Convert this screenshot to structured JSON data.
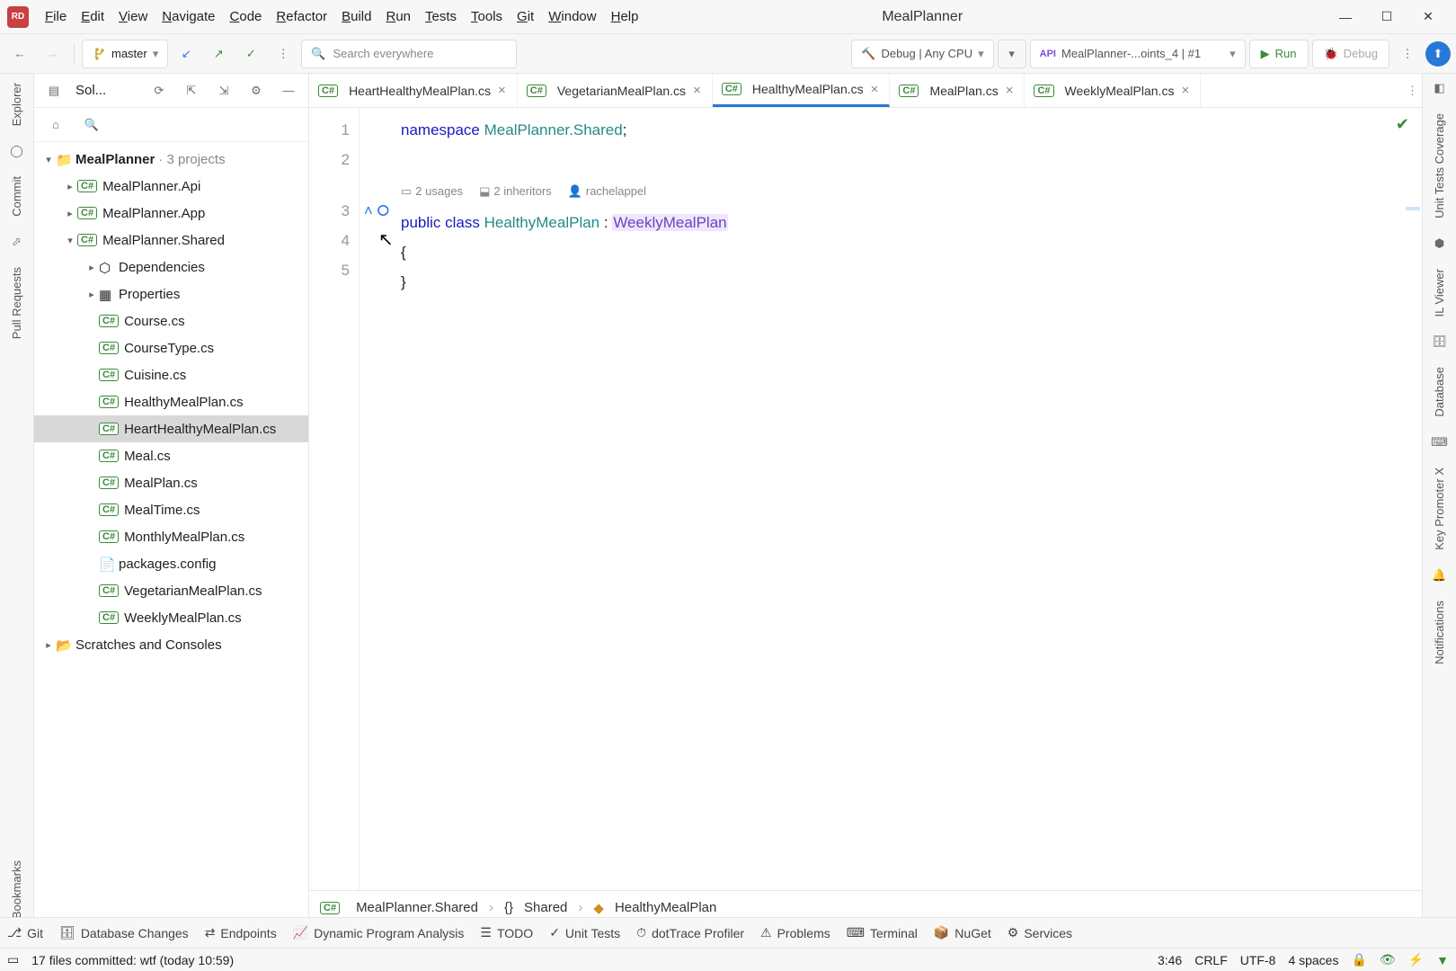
{
  "window": {
    "title": "MealPlanner"
  },
  "menu": [
    "File",
    "Edit",
    "View",
    "Navigate",
    "Code",
    "Refactor",
    "Build",
    "Run",
    "Tests",
    "Tools",
    "Git",
    "Window",
    "Help"
  ],
  "toolbar": {
    "branch": "master",
    "search_placeholder": "Search everywhere",
    "debug_config": "Debug | Any CPU",
    "run_config": "MealPlanner-...oints_4 | #1",
    "run_label": "Run",
    "debug_label": "Debug"
  },
  "explorer": {
    "title": "Sol...",
    "root": {
      "name": "MealPlanner",
      "suffix": "· 3 projects"
    },
    "projects": [
      "MealPlanner.Api",
      "MealPlanner.App",
      "MealPlanner.Shared"
    ],
    "shared_children_folders": [
      "Dependencies",
      "Properties"
    ],
    "shared_files": [
      "Course.cs",
      "CourseType.cs",
      "Cuisine.cs",
      "HealthyMealPlan.cs",
      "HeartHealthyMealPlan.cs",
      "Meal.cs",
      "MealPlan.cs",
      "MealTime.cs",
      "MonthlyMealPlan.cs",
      "packages.config",
      "VegetarianMealPlan.cs",
      "WeeklyMealPlan.cs"
    ],
    "scratches": "Scratches and Consoles",
    "selected_file": "HeartHealthyMealPlan.cs"
  },
  "tabs": [
    {
      "name": "HeartHealthyMealPlan.cs",
      "active": false
    },
    {
      "name": "VegetarianMealPlan.cs",
      "active": false
    },
    {
      "name": "HealthyMealPlan.cs",
      "active": true
    },
    {
      "name": "MealPlan.cs",
      "active": false
    },
    {
      "name": "WeeklyMealPlan.cs",
      "active": false
    }
  ],
  "code": {
    "namespace_kw": "namespace",
    "namespace_name": "MealPlanner.Shared",
    "codelens_usages": "2 usages",
    "codelens_inheritors": "2 inheritors",
    "codelens_author": "rachelappel",
    "public_kw": "public",
    "class_kw": "class",
    "class_name": "HealthyMealPlan",
    "base_name": "WeeklyMealPlan",
    "brace_open": "{",
    "brace_close": "}",
    "line_numbers": [
      "1",
      "2",
      "3",
      "4",
      "5"
    ]
  },
  "breadcrumb": [
    "MealPlanner.Shared",
    "Shared",
    "HealthyMealPlan"
  ],
  "left_sidebar": [
    "Explorer",
    "Commit",
    "Pull Requests",
    "Bookmarks"
  ],
  "right_sidebar": [
    "Unit Tests Coverage",
    "IL Viewer",
    "Database",
    "Key Promoter X",
    "Notifications"
  ],
  "bottom_bar": [
    "Git",
    "Database Changes",
    "Endpoints",
    "Dynamic Program Analysis",
    "TODO",
    "Unit Tests",
    "dotTrace Profiler",
    "Problems",
    "Terminal",
    "NuGet",
    "Services"
  ],
  "status": {
    "msg": "17 files committed: wtf (today 10:59)",
    "caret": "3:46",
    "eol": "CRLF",
    "enc": "UTF-8",
    "indent": "4 spaces"
  }
}
